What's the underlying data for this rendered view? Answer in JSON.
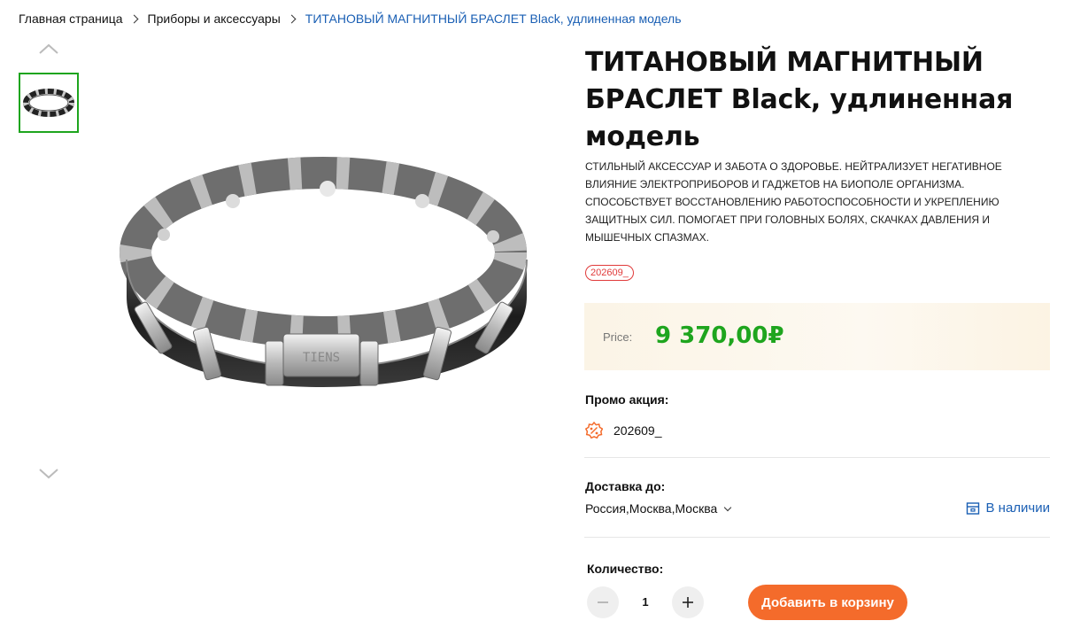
{
  "breadcrumb": {
    "home": "Главная страница",
    "category": "Приборы и аксессуары",
    "current": "ТИТАНОВЫЙ МАГНИТНЫЙ БРАСЛЕТ Black, удлиненная модель"
  },
  "product": {
    "title": "ТИТАНОВЫЙ МАГНИТНЫЙ БРАСЛЕТ Black, удлиненная модель",
    "description": "Стильный аксессуар и забота о здоровье. Нейтрализует негативное влияние электроприборов и гаджетов на биополе организма. Способствует восстановлению работоспособности и укреплению защитных сил. Помогает при головных болях, скачках давления и мышечных спазмах.",
    "code_badge": "202609_",
    "engraving": "TIENS"
  },
  "price": {
    "label": "Price:",
    "value": "9 370,00₽"
  },
  "promo": {
    "title": "Промо акция:",
    "item": "202609_"
  },
  "delivery": {
    "title": "Доставка до:",
    "location": "Россия,Москва,Москва",
    "stock": "В наличии"
  },
  "quantity": {
    "title": "Количество:",
    "value": "1"
  },
  "actions": {
    "add_to_cart": "Добавить в корзину"
  },
  "colors": {
    "accent_green": "#1ea51e",
    "link_blue": "#1a5fb4",
    "cart_orange": "#f46b2b",
    "badge_red": "#e03a3a"
  },
  "icons": {
    "gallery_up": "chevron-up-icon",
    "gallery_down": "chevron-down-icon",
    "promo": "percent-badge-icon",
    "stock": "box-icon",
    "minus": "minus-icon",
    "plus": "plus-icon"
  }
}
